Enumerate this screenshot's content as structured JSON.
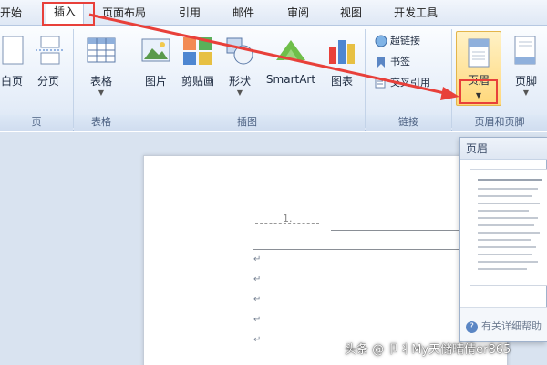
{
  "tabs": [
    {
      "label": "开始"
    },
    {
      "label": "插入"
    },
    {
      "label": "页面布局"
    },
    {
      "label": "引用"
    },
    {
      "label": "邮件"
    },
    {
      "label": "审阅"
    },
    {
      "label": "视图"
    },
    {
      "label": "开发工具"
    }
  ],
  "ribbon": {
    "groups": {
      "pages": {
        "label": "页",
        "buttons": {
          "blank": "白页",
          "break": "分页"
        }
      },
      "tables": {
        "label": "表格",
        "table": "表格"
      },
      "illustrations": {
        "label": "插图",
        "picture": "图片",
        "clipart": "剪贴画",
        "shapes": "形状",
        "smartart": "SmartArt",
        "chart": "图表"
      },
      "links": {
        "label": "链接",
        "hyperlink": "超链接",
        "bookmark": "书签",
        "crossref": "交叉引用"
      },
      "headerfooter": {
        "label": "页眉和页脚",
        "header": "页眉",
        "footer": "页脚"
      }
    }
  },
  "document": {
    "page_number": "1.",
    "para_mark": "↵"
  },
  "gallery": {
    "title": "页眉",
    "help": "有关详细帮助"
  },
  "watermark": "头条 @ 卩丬My天储晴倩er865",
  "colors": {
    "highlight_red": "#e8403a",
    "ribbon_blue": "#dfe8f5",
    "pressed_yellow": "#ffd77a"
  }
}
